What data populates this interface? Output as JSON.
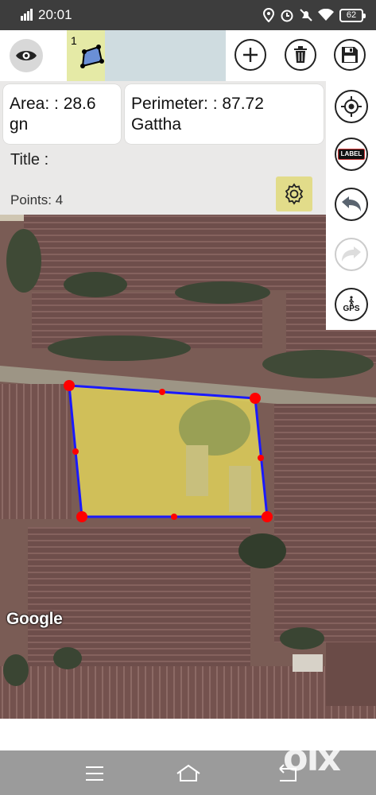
{
  "status_bar": {
    "time": "20:01",
    "battery": "62",
    "network_icon": "signal-4g-icon",
    "icons": [
      "location-icon",
      "alarm-icon",
      "mute-icon",
      "wifi-icon",
      "battery-icon"
    ]
  },
  "toolbar": {
    "shape_tab_number": "1",
    "eye_icon": "eye-icon",
    "add_icon": "plus-icon",
    "delete_icon": "trash-icon",
    "save_icon": "floppy-disk-icon"
  },
  "info": {
    "area_text": "Area: : 28.6 gn",
    "perimeter_text": "Perimeter: : 87.72 Gattha",
    "title_label": "Title :",
    "points_label": "Points: 4"
  },
  "sidebar": {
    "location_icon": "crosshair-icon",
    "label_text": "LABEL",
    "undo_icon": "undo-icon",
    "redo_icon": "redo-icon",
    "gps_text": "GPS"
  },
  "map": {
    "attribution": "Google",
    "polygon_fill": "#e9e05a",
    "polygon_stroke": "#1a1aff",
    "vertex_color": "#ff0000"
  },
  "nav": {
    "icons": [
      "menu-icon",
      "home-icon",
      "back-icon"
    ]
  },
  "watermark": "olx"
}
